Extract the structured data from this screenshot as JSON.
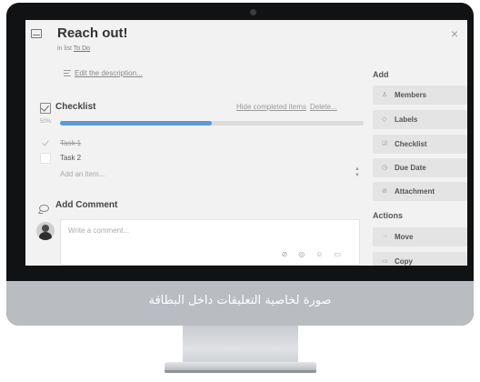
{
  "card": {
    "title": "Reach out!",
    "in_list_prefix": "in list",
    "list_name": "To Do",
    "close_glyph": "×"
  },
  "description": {
    "link": "Edit the description..."
  },
  "checklist": {
    "title": "Checklist",
    "hide_completed": "Hide completed items",
    "delete": "Delete...",
    "percent_label": "50%",
    "progress": 0.5,
    "items": [
      {
        "label": "Task 1",
        "done": true
      },
      {
        "label": "Task 2",
        "done": false
      }
    ],
    "add_item_placeholder": "Add an item..."
  },
  "comment": {
    "title": "Add Comment",
    "placeholder": "Write a comment...",
    "icons": [
      "attachment-icon",
      "mention-icon",
      "emoji-icon",
      "card-icon"
    ]
  },
  "sidebar": {
    "add_heading": "Add",
    "add_buttons": [
      {
        "label": "Members",
        "icon": "person-icon"
      },
      {
        "label": "Labels",
        "icon": "tag-icon"
      },
      {
        "label": "Checklist",
        "icon": "checkbox-icon"
      },
      {
        "label": "Due Date",
        "icon": "clock-icon"
      },
      {
        "label": "Attachment",
        "icon": "paperclip-icon"
      }
    ],
    "actions_heading": "Actions",
    "action_buttons": [
      {
        "label": "Move",
        "icon": "arrow-right-icon"
      },
      {
        "label": "Copy",
        "icon": "copy-icon"
      }
    ]
  },
  "caption": "صورة لخاصية التعليقات داخل البطاقة"
}
